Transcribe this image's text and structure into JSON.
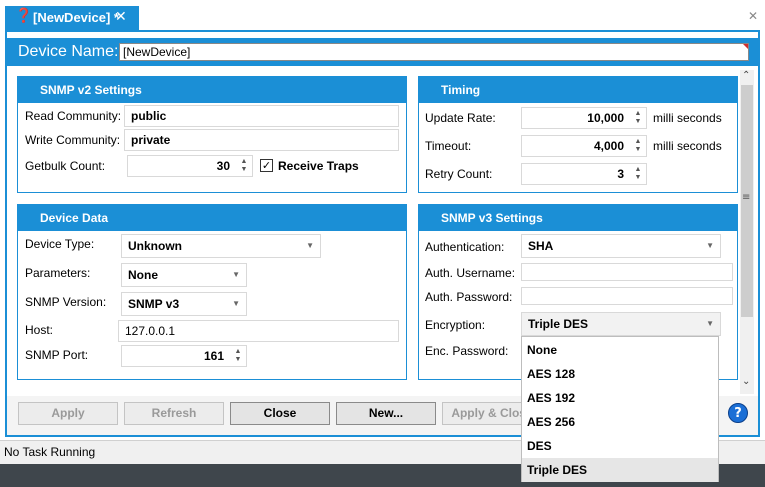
{
  "tab": {
    "icon": "question-mark-icon",
    "title": "[NewDevice] *",
    "close": "✕"
  },
  "window_close": "✕",
  "device_name": {
    "label": "Device Name:",
    "value": "[NewDevice]"
  },
  "snmp_v2": {
    "title": "SNMP v2 Settings",
    "read_community_label": "Read Community:",
    "read_community": "public",
    "write_community_label": "Write Community:",
    "write_community": "private",
    "getbulk_label": "Getbulk Count:",
    "getbulk": "30",
    "receive_traps_label": "Receive Traps",
    "receive_traps_checked": true
  },
  "timing": {
    "title": "Timing",
    "update_rate_label": "Update Rate:",
    "update_rate": "10,000",
    "update_rate_unit": "milli seconds",
    "timeout_label": "Timeout:",
    "timeout": "4,000",
    "timeout_unit": "milli seconds",
    "retry_label": "Retry Count:",
    "retry": "3"
  },
  "device_data": {
    "title": "Device Data",
    "device_type_label": "Device Type:",
    "device_type": "Unknown",
    "parameters_label": "Parameters:",
    "parameters": "None",
    "snmp_version_label": "SNMP Version:",
    "snmp_version": "SNMP v3",
    "host_label": "Host:",
    "host": "127.0.0.1",
    "port_label": "SNMP Port:",
    "port": "161"
  },
  "snmp_v3": {
    "title": "SNMP v3 Settings",
    "auth_label": "Authentication:",
    "auth": "SHA",
    "auth_user_label": "Auth. Username:",
    "auth_user": "",
    "auth_pass_label": "Auth. Password:",
    "auth_pass": "",
    "encryption_label": "Encryption:",
    "encryption": "Triple DES",
    "enc_pass_label": "Enc. Password:",
    "encryption_options": [
      "None",
      "AES 128",
      "AES  192",
      "AES 256",
      "DES",
      "Triple DES"
    ],
    "encryption_selected_index": 5
  },
  "buttons": {
    "apply": "Apply",
    "refresh": "Refresh",
    "close": "Close",
    "new": "New...",
    "apply_close": "Apply & Close"
  },
  "status": {
    "text": "No Task Running"
  },
  "colors": {
    "accent": "#1b8fd6",
    "dropdown_selected": "#e6e6e6",
    "status_bar": "#3f464c"
  }
}
